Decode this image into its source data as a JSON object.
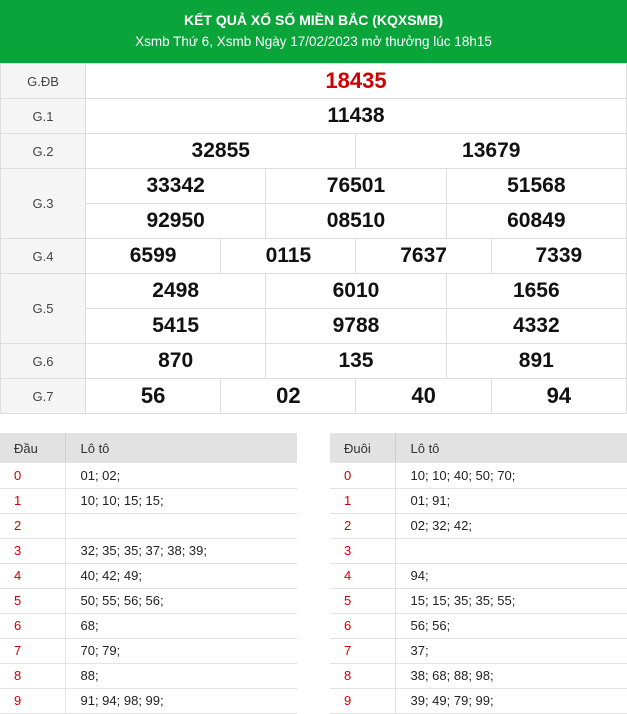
{
  "header": {
    "title": "KẾT QUẢ XỔ SỐ MIỀN BẮC (KQXSMB)",
    "subtitle": "Xsmb Thứ 6, Xsmb Ngày 17/02/2023 mở thưởng lúc 18h15"
  },
  "prizes": {
    "gdb": {
      "label": "G.ĐB",
      "nums": [
        "18435"
      ]
    },
    "g1": {
      "label": "G.1",
      "nums": [
        "11438"
      ]
    },
    "g2": {
      "label": "G.2",
      "nums": [
        "32855",
        "13679"
      ]
    },
    "g3": {
      "label": "G.3",
      "nums": [
        "33342",
        "76501",
        "51568",
        "92950",
        "08510",
        "60849"
      ]
    },
    "g4": {
      "label": "G.4",
      "nums": [
        "6599",
        "0115",
        "7637",
        "7339"
      ]
    },
    "g5": {
      "label": "G.5",
      "nums": [
        "2498",
        "6010",
        "1656",
        "5415",
        "9788",
        "4332"
      ]
    },
    "g6": {
      "label": "G.6",
      "nums": [
        "870",
        "135",
        "891"
      ]
    },
    "g7": {
      "label": "G.7",
      "nums": [
        "56",
        "02",
        "40",
        "94"
      ]
    }
  },
  "dau": {
    "h1": "Đầu",
    "h2": "Lô tô",
    "rows": [
      {
        "k": "0",
        "v": "01; 02;"
      },
      {
        "k": "1",
        "v": "10; 10; 15; 15;"
      },
      {
        "k": "2",
        "v": ""
      },
      {
        "k": "3",
        "v": "32; 35; 35; 37; 38; 39;"
      },
      {
        "k": "4",
        "v": "40; 42; 49;"
      },
      {
        "k": "5",
        "v": "50; 55; 56; 56;"
      },
      {
        "k": "6",
        "v": "68;"
      },
      {
        "k": "7",
        "v": "70; 79;"
      },
      {
        "k": "8",
        "v": "88;"
      },
      {
        "k": "9",
        "v": "91; 94; 98; 99;"
      }
    ]
  },
  "duoi": {
    "h1": "Đuôi",
    "h2": "Lô tô",
    "rows": [
      {
        "k": "0",
        "v": "10; 10; 40; 50; 70;"
      },
      {
        "k": "1",
        "v": "01; 91;"
      },
      {
        "k": "2",
        "v": "02; 32; 42;"
      },
      {
        "k": "3",
        "v": ""
      },
      {
        "k": "4",
        "v": "94;"
      },
      {
        "k": "5",
        "v": "15; 15; 35; 35; 55;"
      },
      {
        "k": "6",
        "v": "56; 56;"
      },
      {
        "k": "7",
        "v": "37;"
      },
      {
        "k": "8",
        "v": "38; 68; 88; 98;"
      },
      {
        "k": "9",
        "v": "39; 49; 79; 99;"
      }
    ]
  }
}
